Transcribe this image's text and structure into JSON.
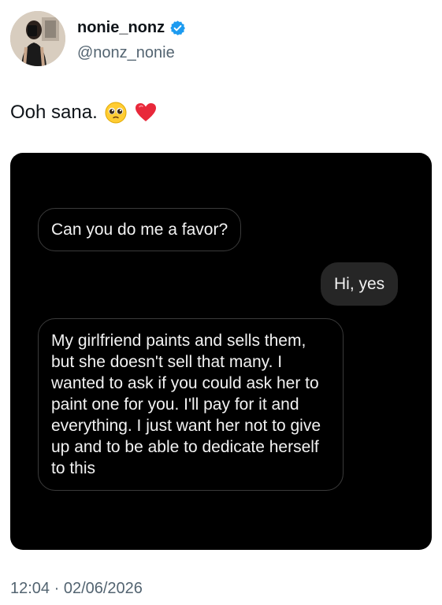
{
  "author": {
    "display_name": "nonie_nonz",
    "handle": "@nonz_nonie",
    "verified": true,
    "avatar_icon": "avatar-photo"
  },
  "tweet": {
    "text": "Ooh sana.",
    "emojis": [
      "pleading-face-emoji",
      "red-heart-emoji"
    ],
    "timestamp": "12:04 · 02/06/2026"
  },
  "media": {
    "messages": [
      {
        "side": "received",
        "text": "Can you do me a favor?"
      },
      {
        "side": "sent",
        "text": "Hi, yes"
      },
      {
        "side": "received",
        "text": "My girlfriend paints and sells them, but she doesn't sell that many. I wanted to ask if you could ask her to paint one for you. I'll pay for it and everything. I just want her not to give up and to be able to dedicate herself to this"
      }
    ]
  },
  "colors": {
    "verified_badge": "#1d9bf0",
    "media_background": "#000000",
    "sent_bubble": "#262626"
  }
}
